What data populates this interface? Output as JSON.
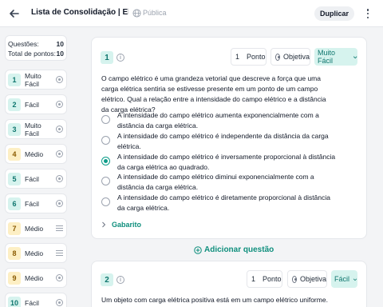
{
  "header": {
    "title": "Lista de Consolidação | Elet...",
    "visibility": "Pública",
    "duplicate_label": "Duplicar"
  },
  "stats": {
    "questions_label": "Questões:",
    "questions_value": "10",
    "points_label": "Total de pontos:",
    "points_value": "10"
  },
  "sidebar": {
    "items": [
      {
        "num": "1",
        "label": "Muito Fácil",
        "icon": "radio-icon"
      },
      {
        "num": "2",
        "label": "Fácil",
        "icon": "radio-icon"
      },
      {
        "num": "3",
        "label": "Muito Fácil",
        "icon": "radio-icon"
      },
      {
        "num": "4",
        "label": "Médio",
        "icon": "radio-icon"
      },
      {
        "num": "5",
        "label": "Fácil",
        "icon": "radio-icon"
      },
      {
        "num": "6",
        "label": "Fácil",
        "icon": "radio-icon"
      },
      {
        "num": "7",
        "label": "Médio",
        "icon": "lines-icon"
      },
      {
        "num": "8",
        "label": "Médio",
        "icon": "lines-icon"
      },
      {
        "num": "9",
        "label": "Médio",
        "icon": "radio-icon"
      },
      {
        "num": "10",
        "label": "Fácil",
        "icon": "radio-icon"
      }
    ]
  },
  "question1": {
    "number": "1",
    "points_value": "1",
    "points_unit": "Ponto",
    "type": "Objetiva",
    "difficulty": "Muito Fácil",
    "text": "O campo elétrico é uma grandeza vetorial que descreve a força que uma carga elétrica sentiria se estivesse presente em um ponto de um campo elétrico. Qual a relação entre a intensidade do campo elétrico e a distância da carga elétrica?",
    "options": [
      {
        "text": "A intensidade do campo elétrico aumenta exponencialmente com a distância da carga elétrica.",
        "selected": false
      },
      {
        "text": "A intensidade do campo elétrico é independente da distância da carga elétrica.",
        "selected": false
      },
      {
        "text": "A intensidade do campo elétrico é inversamente proporcional à distância da carga elétrica ao quadrado.",
        "selected": true
      },
      {
        "text": "A intensidade do campo elétrico diminui exponencialmente com a distância da carga elétrica.",
        "selected": false
      },
      {
        "text": "A intensidade do campo elétrico é diretamente proporcional à distância da carga elétrica.",
        "selected": false
      }
    ],
    "answer_key_label": "Gabarito"
  },
  "add_question_label": "Adicionar questão",
  "question2": {
    "number": "2",
    "points_value": "1",
    "points_unit": "Ponto",
    "type": "Objetiva",
    "difficulty": "Fácil",
    "text": "Um objeto com carga elétrica positiva está em um campo elétrico uniforme. Qual é"
  },
  "colors": {
    "accent": "#0f8f7d",
    "easy_bg": "#d6f3ee",
    "medium_bg": "#fdefc4"
  }
}
